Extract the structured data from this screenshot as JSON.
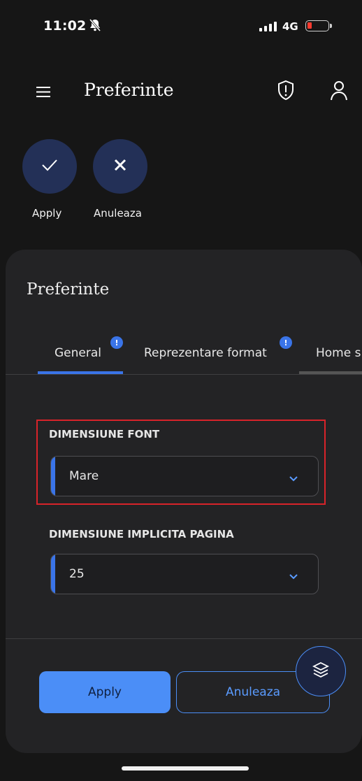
{
  "status_bar": {
    "time": "11:02",
    "network": "4G",
    "battery_color": "#ff3b30"
  },
  "header": {
    "title": "Preferinte",
    "icons": [
      "menu-icon",
      "shield-alert-icon",
      "user-icon"
    ]
  },
  "actions": [
    {
      "label": "Apply",
      "icon": "check-icon"
    },
    {
      "label": "Anuleaza",
      "icon": "close-icon"
    }
  ],
  "card": {
    "title": "Preferinte",
    "tabs": [
      {
        "label": "General",
        "badge": "!",
        "active": true
      },
      {
        "label": "Reprezentare format",
        "badge": "!"
      },
      {
        "label": "Home s"
      }
    ],
    "fields": [
      {
        "label": "DIMENSIUNE FONT",
        "value": "Mare"
      },
      {
        "label": "DIMENSIUNE IMPLICITA PAGINA",
        "value": "25"
      }
    ],
    "buttons": {
      "apply": "Apply",
      "cancel": "Anuleaza"
    },
    "fab_icon": "layers-icon"
  },
  "colors": {
    "accent": "#3a74e8",
    "primary_button": "#4b8ef7",
    "highlight_border": "#d8232a",
    "action_circle": "#233057"
  }
}
